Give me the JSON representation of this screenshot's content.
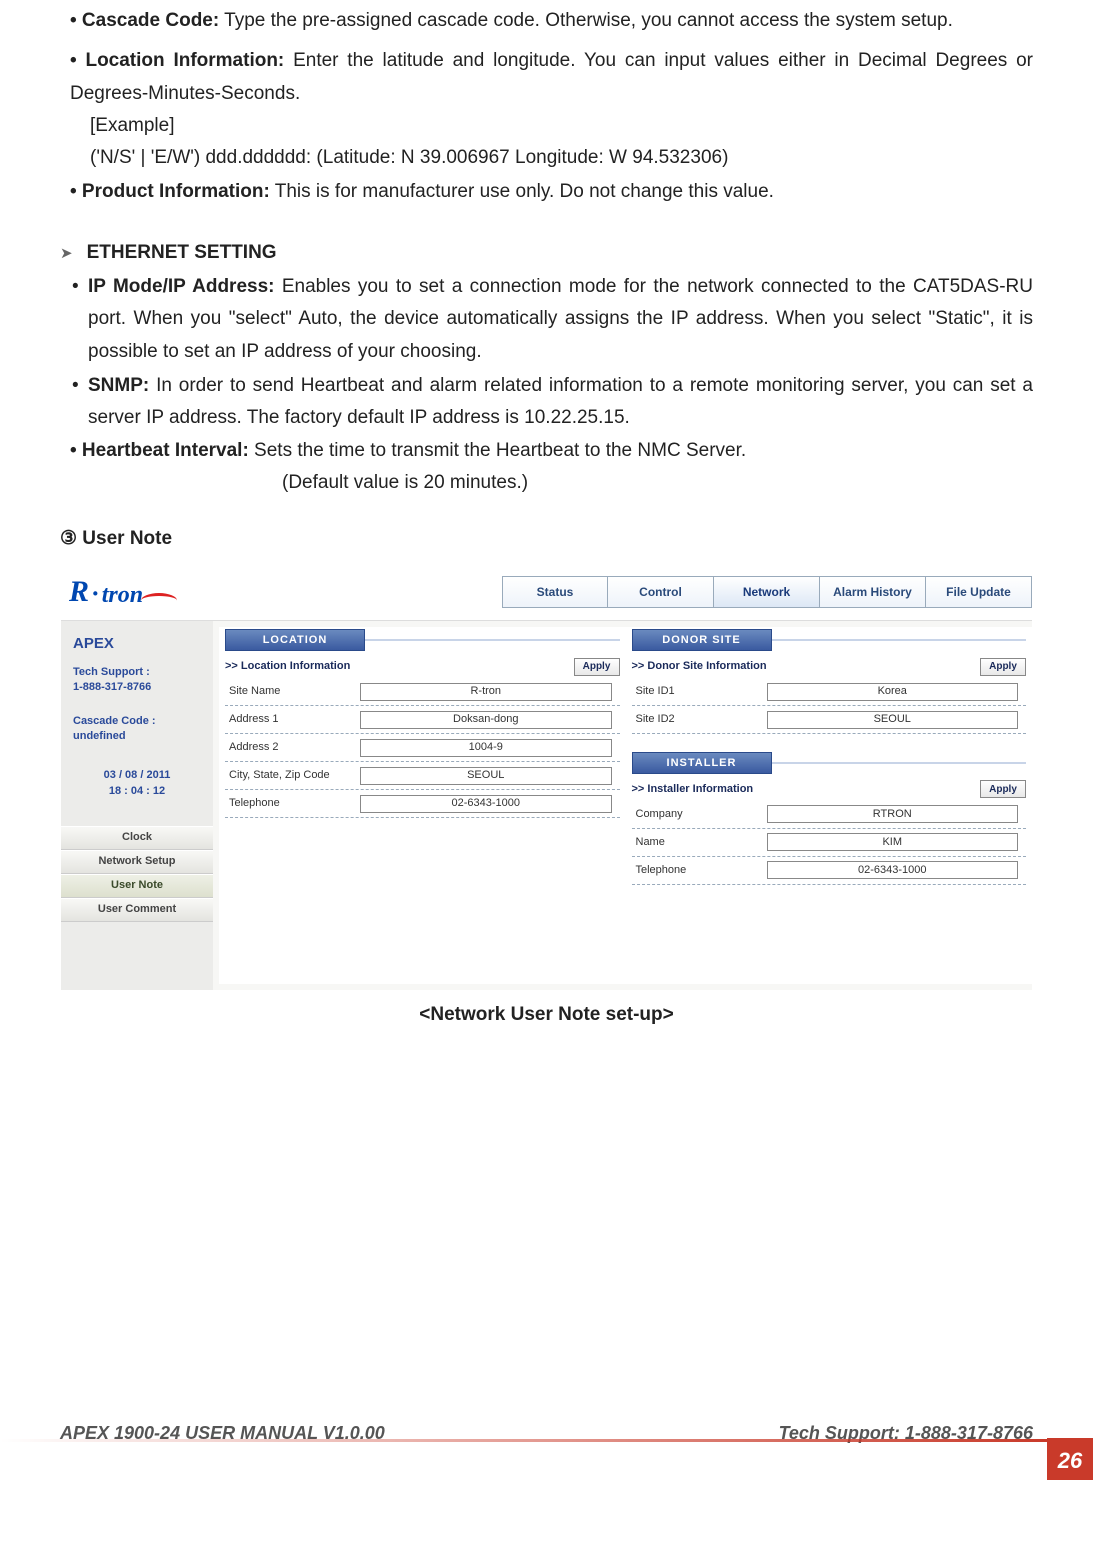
{
  "para": {
    "cascade_label": "• Cascade Code:",
    "cascade_text": " Type the pre-assigned cascade code. Otherwise, you cannot access the system setup.",
    "location_label": "• Location Information:",
    "location_text": " Enter the latitude and longitude. You can input values either in Decimal Degrees or Degrees-Minutes-Seconds.",
    "example_label": "[Example]",
    "example_text": "('N/S' | 'E/W') ddd.dddddd: (Latitude: N 39.006967 Longitude: W 94.532306)",
    "product_label": "• Product Information:",
    "product_text": " This is for manufacturer use only. Do not change this value.",
    "eth_title": "ETHERNET SETTING",
    "ipmode_label": "IP Mode/IP Address:",
    "ipmode_text": " Enables you to set a connection mode for the network connected to the CAT5DAS-RU port. When you \"select\" Auto, the device automatically assigns the IP address. When you select \"Static\", it is possible to set an IP address of your choosing.",
    "snmp_label": "SNMP:",
    "snmp_text": " In order to send Heartbeat and alarm related information to a remote monitoring server, you can set a server IP address. The factory default IP address is 10.22.25.15.",
    "hb_label": "• Heartbeat Interval:",
    "hb_text": " Sets the time to transmit the Heartbeat to the NMC Server.",
    "hb_default": "(Default value is 20 minutes.)",
    "usernote_title": "③ User Note",
    "caption": "<Network User Note set-up>"
  },
  "tabs": {
    "t1": "Status",
    "t2": "Control",
    "t3": "Network",
    "t4": "Alarm History",
    "t5": "File Update"
  },
  "sidebar": {
    "brand": "APEX",
    "tech1": "Tech Support :",
    "tech2": "1-888-317-8766",
    "casc1": "Cascade Code :",
    "casc2": "undefined",
    "date": "03 / 08 / 2011",
    "time": "18 : 04 : 12",
    "m1": "Clock",
    "m2": "Network Setup",
    "m3": "User Note",
    "m4": "User Comment"
  },
  "loc": {
    "hdr": "LOCATION",
    "sub": ">> Location Information",
    "apply": "Apply",
    "f1l": "Site Name",
    "f1v": "R-tron",
    "f2l": "Address 1",
    "f2v": "Doksan-dong",
    "f3l": "Address 2",
    "f3v": "1004-9",
    "f4l": "City, State, Zip Code",
    "f4v": "SEOUL",
    "f5l": "Telephone",
    "f5v": "02-6343-1000"
  },
  "donor": {
    "hdr": "DONOR SITE",
    "sub": ">> Donor Site Information",
    "apply": "Apply",
    "f1l": "Site ID1",
    "f1v": "Korea",
    "f2l": "Site ID2",
    "f2v": "SEOUL"
  },
  "inst": {
    "hdr": "INSTALLER",
    "sub": ">> Installer Information",
    "apply": "Apply",
    "f1l": "Company",
    "f1v": "RTRON",
    "f2l": "Name",
    "f2v": "KIM",
    "f3l": "Telephone",
    "f3v": "02-6343-1000"
  },
  "footer": {
    "left": "APEX 1900-24 USER MANUAL V1.0.00",
    "right": "Tech Support: 1-888-317-8766",
    "page": "26"
  }
}
